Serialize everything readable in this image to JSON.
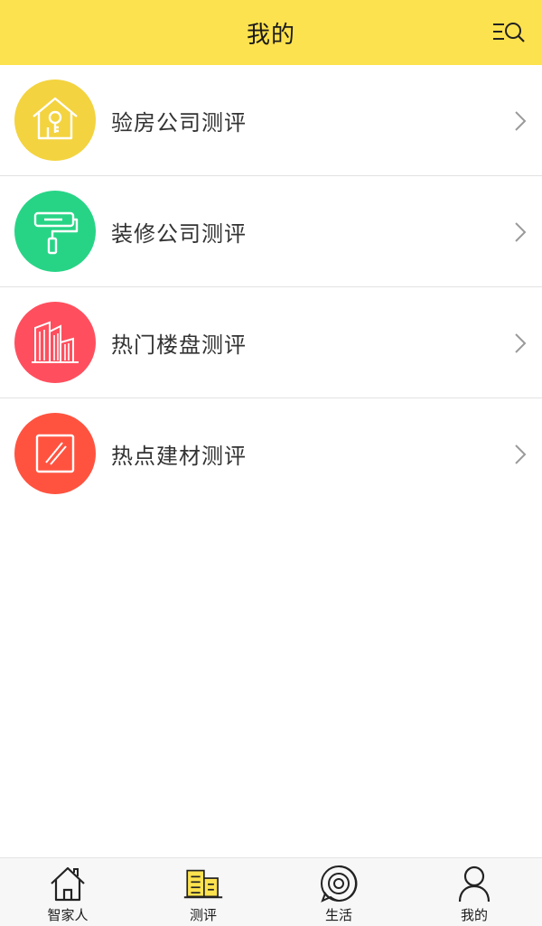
{
  "header": {
    "title": "我的",
    "search_icon": "menu-search-icon"
  },
  "list": {
    "items": [
      {
        "label": "验房公司测评",
        "icon": "house-key-icon",
        "color": "#F3D33F"
      },
      {
        "label": "装修公司测评",
        "icon": "paint-roller-icon",
        "color": "#27D486"
      },
      {
        "label": "热门楼盘测评",
        "icon": "buildings-icon",
        "color": "#FF4F5E"
      },
      {
        "label": "热点建材测评",
        "icon": "material-panel-icon",
        "color": "#FF5340"
      }
    ]
  },
  "tabbar": {
    "tabs": [
      {
        "label": "智家人",
        "icon": "home-icon"
      },
      {
        "label": "测评",
        "icon": "buildings-icon",
        "active": true,
        "active_color": "#FDE24F"
      },
      {
        "label": "生活",
        "icon": "life-target-icon"
      },
      {
        "label": "我的",
        "icon": "person-icon"
      }
    ]
  }
}
